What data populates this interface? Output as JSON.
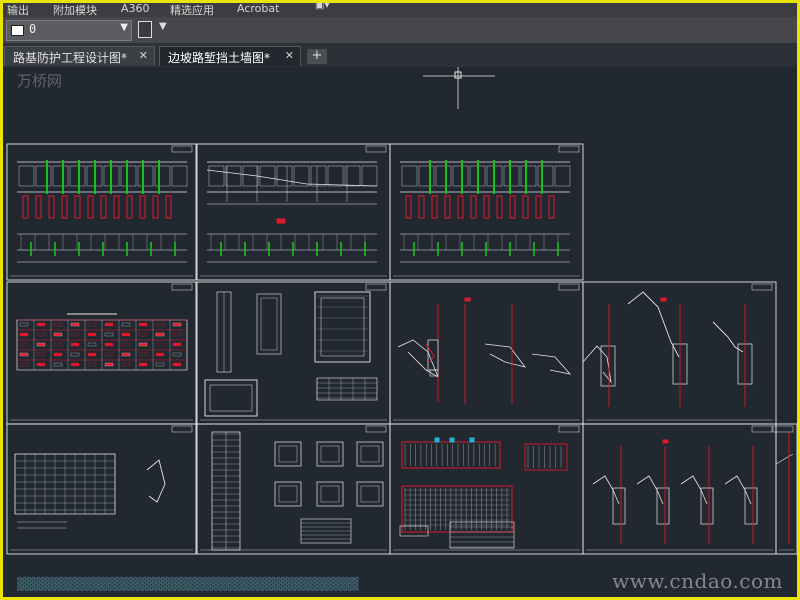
{
  "menu": {
    "items": [
      "输出",
      "附加模块",
      "A360",
      "精选应用",
      "Acrobat"
    ]
  },
  "toolbar": {
    "layer_value": "0"
  },
  "tabs": [
    {
      "label": "路基防护工程设计图*",
      "active": false
    },
    {
      "label": "边坡路堑挡土墙图*",
      "active": true
    }
  ],
  "watermarks": {
    "top": "万桥网",
    "bottom": "www.cndao.com"
  },
  "colors": {
    "background": "#212830",
    "frame_border": "#e9e400",
    "line_white": "#e8e8e8",
    "line_red": "#e0182b",
    "line_green": "#19c21a"
  },
  "icons": {
    "close_tab": "close-icon",
    "add_tab": "plus-icon",
    "layer_dropdown": "chevron-down-icon"
  }
}
